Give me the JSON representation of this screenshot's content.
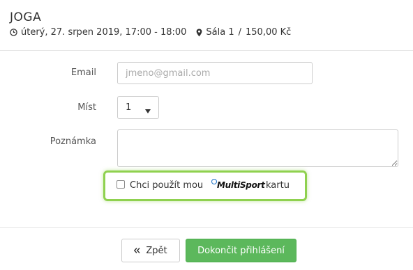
{
  "event": {
    "title": "JOGA",
    "datetime": "úterý, 27. srpen 2019, 17:00 - 18:00",
    "location": "Sála 1",
    "separator": "/",
    "price": "150,00 Kč"
  },
  "form": {
    "email": {
      "label": "Email",
      "placeholder": "jmeno@gmail.com",
      "value": ""
    },
    "places": {
      "label": "Míst",
      "value": "1"
    },
    "note": {
      "label": "Poznámka",
      "value": ""
    },
    "multisport": {
      "checked": false,
      "text_before": "Chci použít mou",
      "logo_text": "MultiSport",
      "text_after": "kartu",
      "highlight_color": "#8fd14f"
    }
  },
  "footer": {
    "back_label": "Zpět",
    "finish_label": "Dokončit přihlášení",
    "finish_color": "#5cb85c"
  }
}
